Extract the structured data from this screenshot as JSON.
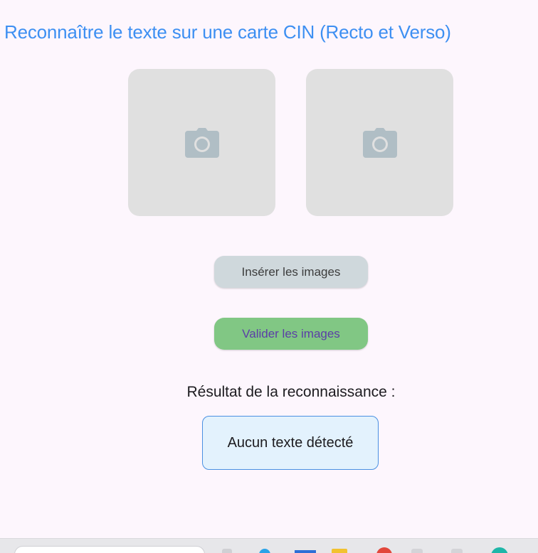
{
  "page": {
    "title": "Reconnaître le texte sur une carte CIN (Recto et Verso)"
  },
  "images": {
    "slots": [
      {
        "side": "recto",
        "icon": "camera-icon"
      },
      {
        "side": "verso",
        "icon": "camera-icon"
      }
    ],
    "placeholder_bg": "#e0e0e0",
    "icon_color": "#b0bec5"
  },
  "actions": {
    "insert_label": "Insérer les images",
    "validate_label": "Valider les images"
  },
  "result": {
    "label": "Résultat de la reconnaissance :",
    "text": "Aucun texte détecté"
  },
  "colors": {
    "title": "#3d8ff2",
    "insert_button": "#cfd8dc",
    "validate_button": "#81c784",
    "validate_text": "#5b3ea6",
    "result_border": "#4a90e2",
    "result_bg": "#e3f2fd",
    "background": "#fdf6fd"
  },
  "taskbar": {
    "icons": [
      "search-box",
      "task-view-icon",
      "edge-icon",
      "store-icon",
      "file-explorer-icon",
      "chrome-icon",
      "app-icon",
      "app-icon",
      "app-icon"
    ]
  }
}
